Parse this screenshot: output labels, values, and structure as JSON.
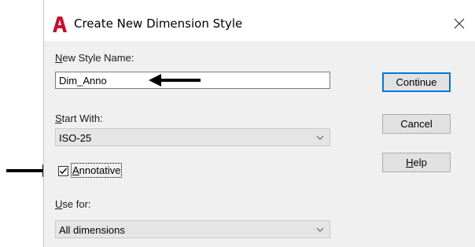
{
  "dialog": {
    "title": "Create New Dimension Style",
    "brand_color": "#c8102e",
    "new_style_name": {
      "label_accel": "N",
      "label_rest": "ew Style Name:",
      "value": "Dim_Anno"
    },
    "start_with": {
      "label_accel": "S",
      "label_rest": "tart With:",
      "selected": "ISO-25"
    },
    "annotative": {
      "label_accel": "A",
      "label_rest": "nnotative",
      "checked": true
    },
    "use_for": {
      "label_accel": "U",
      "label_rest": "se for:",
      "selected": "All dimensions"
    },
    "buttons": {
      "continue": "Continue",
      "cancel": "Cancel",
      "help_accel": "H",
      "help_rest": "elp"
    },
    "icons": {
      "app": "autocad-a-icon",
      "close": "close-x-icon",
      "dropdown": "chevron-down-icon",
      "check": "checkmark-icon",
      "arrow": "black-arrow-pointer"
    }
  }
}
